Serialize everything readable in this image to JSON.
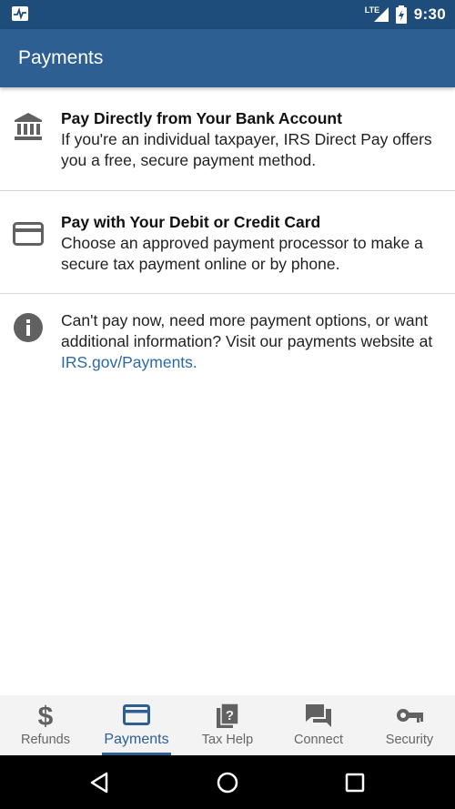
{
  "status_bar": {
    "network": "LTE",
    "time": "9:30"
  },
  "app_bar": {
    "title": "Payments"
  },
  "list": {
    "items": [
      {
        "icon": "bank-icon",
        "heading": "Pay Directly from Your Bank Account",
        "body": "If you're an individual taxpayer, IRS Direct Pay offers you a free, secure payment method."
      },
      {
        "icon": "credit-card-icon",
        "heading": "Pay with Your Debit or Credit Card",
        "body": "Choose an approved payment processor to make a secure tax payment online or by phone."
      },
      {
        "icon": "info-icon",
        "body": "Can't pay now, need more payment options, or want additional information? Visit our payments website at",
        "link": "IRS.gov/Payments."
      }
    ]
  },
  "bottom_nav": {
    "items": [
      {
        "label": "Refunds",
        "icon": "dollar-icon",
        "active": false
      },
      {
        "label": "Payments",
        "icon": "credit-card-icon",
        "active": true
      },
      {
        "label": "Tax Help",
        "icon": "help-document-icon",
        "active": false
      },
      {
        "label": "Connect",
        "icon": "chat-icon",
        "active": false
      },
      {
        "label": "Security",
        "icon": "key-icon",
        "active": false
      }
    ]
  },
  "colors": {
    "status_bar": "#1e4d7b",
    "app_bar": "#2d5f93",
    "active_nav": "#2d5f93",
    "link": "#2c6aa6",
    "icon_gray": "#616161"
  }
}
